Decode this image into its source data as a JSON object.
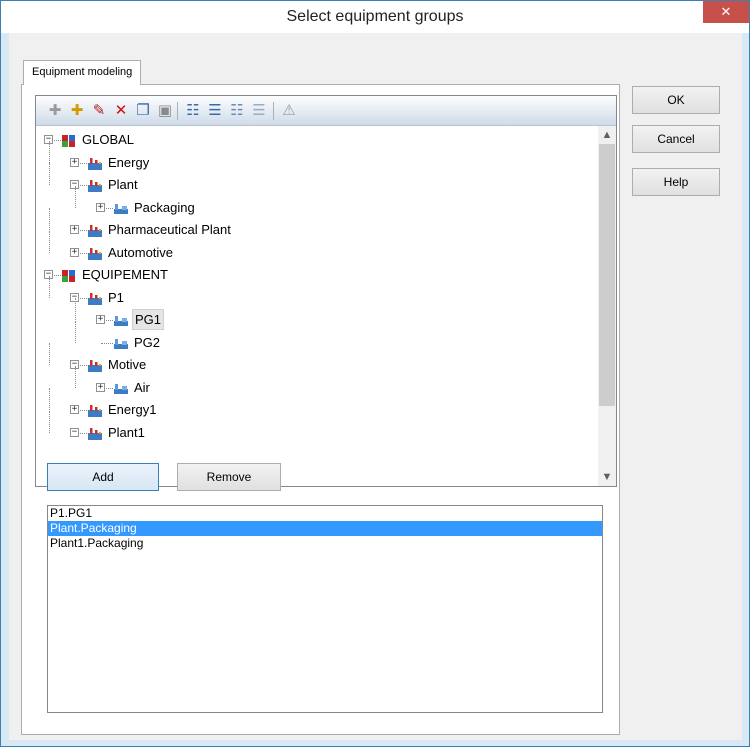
{
  "window": {
    "title": "Select equipment groups",
    "close_glyph": "✕"
  },
  "tab": {
    "label": "Equipment modeling"
  },
  "toolbar": {
    "icons": [
      "new-group-icon",
      "new-subgroup-icon",
      "edit-icon",
      "delete-icon",
      "copy-icon",
      "paste-icon",
      "expand-all-icon",
      "collapse-all-icon",
      "expand-level-icon",
      "collapse-level-icon",
      "warning-icon"
    ]
  },
  "tree": {
    "nodes": [
      {
        "label": "GLOBAL",
        "depth": 0,
        "expander": "−",
        "icon": "root-icon",
        "root_color": "#cc2222"
      },
      {
        "label": "Energy",
        "depth": 1,
        "expander": "+",
        "icon": "plant-icon"
      },
      {
        "label": "Plant",
        "depth": 1,
        "expander": "−",
        "icon": "plant-icon"
      },
      {
        "label": "Packaging",
        "depth": 2,
        "expander": "+",
        "icon": "group-icon"
      },
      {
        "label": "Pharmaceutical Plant",
        "depth": 1,
        "expander": "+",
        "icon": "plant-icon"
      },
      {
        "label": "Automotive",
        "depth": 1,
        "expander": "+",
        "icon": "plant-icon"
      },
      {
        "label": "EQUIPEMENT",
        "depth": 0,
        "expander": "−",
        "icon": "root-icon",
        "root_color": "#cc2222"
      },
      {
        "label": "P1",
        "depth": 1,
        "expander": "−",
        "icon": "plant-icon"
      },
      {
        "label": "PG1",
        "depth": 2,
        "expander": "+",
        "icon": "group-icon",
        "selected": true
      },
      {
        "label": "PG2",
        "depth": 2,
        "expander": "",
        "icon": "group-icon"
      },
      {
        "label": "Motive",
        "depth": 1,
        "expander": "−",
        "icon": "plant-icon"
      },
      {
        "label": "Air",
        "depth": 2,
        "expander": "+",
        "icon": "group-icon"
      },
      {
        "label": "Energy1",
        "depth": 1,
        "expander": "+",
        "icon": "plant-icon"
      },
      {
        "label": "Plant1",
        "depth": 1,
        "expander": "−",
        "icon": "plant-icon"
      }
    ]
  },
  "buttons": {
    "add": "Add",
    "remove": "Remove",
    "ok": "OK",
    "cancel": "Cancel",
    "help": "Help"
  },
  "selected_list": {
    "items": [
      "P1.PG1",
      "Plant.Packaging",
      "Plant1.Packaging"
    ],
    "selected_index": 1
  },
  "colors": {
    "selection": "#3399ff",
    "close": "#c7504a",
    "accent_border": "#3c7fb1"
  }
}
